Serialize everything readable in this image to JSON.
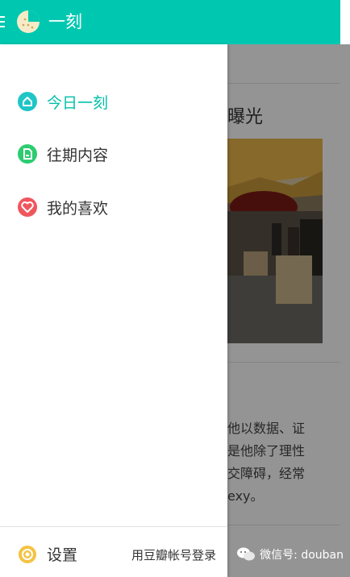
{
  "appbar": {
    "title": "一刻"
  },
  "background": {
    "article_title": "曝光",
    "article_lines": [
      "他以数据、证",
      "是他除了理性",
      "交障碍，经常",
      "exy。"
    ]
  },
  "drawer": {
    "items": [
      {
        "label": "今日一刻",
        "icon": "home-icon",
        "active": true,
        "color": "#1ec6c6"
      },
      {
        "label": "往期内容",
        "icon": "document-icon",
        "active": false,
        "color": "#2ecc71"
      },
      {
        "label": "我的喜欢",
        "icon": "heart-icon",
        "active": false,
        "color": "#f0565e"
      }
    ],
    "footer": {
      "settings_label": "设置",
      "login_label": "用豆瓣帐号登录"
    }
  },
  "watermark": {
    "text": "微信号: douban"
  },
  "colors": {
    "accent": "#00c8b0",
    "settings_icon": "#f5c242"
  }
}
